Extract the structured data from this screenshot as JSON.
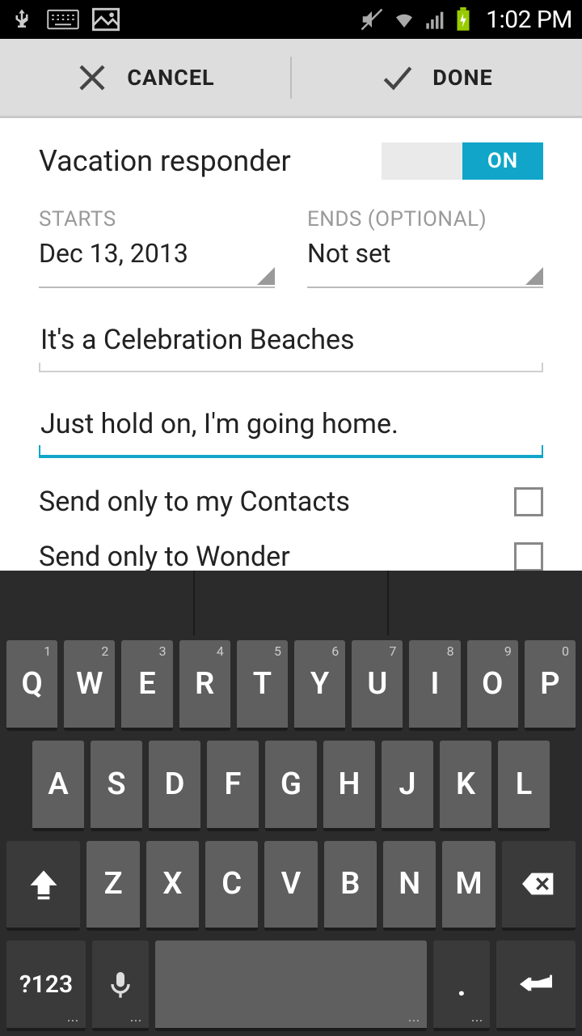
{
  "statusbar": {
    "time": "1:02 PM"
  },
  "actionbar": {
    "cancel": "CANCEL",
    "done": "DONE"
  },
  "page": {
    "title": "Vacation responder",
    "toggle_on": "ON",
    "starts_label": "STARTS",
    "starts_value": "Dec 13, 2013",
    "ends_label": "ENDS (OPTIONAL)",
    "ends_value": "Not set",
    "subject": "It's a Celebration Beaches",
    "body": "Just hold on, I'm going home.",
    "checkbox1": "Send only to my Contacts",
    "checkbox2": "Send only to Wonder"
  },
  "keyboard": {
    "row1": [
      {
        "k": "Q",
        "s": "1"
      },
      {
        "k": "W",
        "s": "2"
      },
      {
        "k": "E",
        "s": "3"
      },
      {
        "k": "R",
        "s": "4"
      },
      {
        "k": "T",
        "s": "5"
      },
      {
        "k": "Y",
        "s": "6"
      },
      {
        "k": "U",
        "s": "7"
      },
      {
        "k": "I",
        "s": "8"
      },
      {
        "k": "O",
        "s": "9"
      },
      {
        "k": "P",
        "s": "0"
      }
    ],
    "row2": [
      "A",
      "S",
      "D",
      "F",
      "G",
      "H",
      "J",
      "K",
      "L"
    ],
    "row3": [
      "Z",
      "X",
      "C",
      "V",
      "B",
      "N",
      "M"
    ],
    "symkey": "?123",
    "period": "."
  }
}
